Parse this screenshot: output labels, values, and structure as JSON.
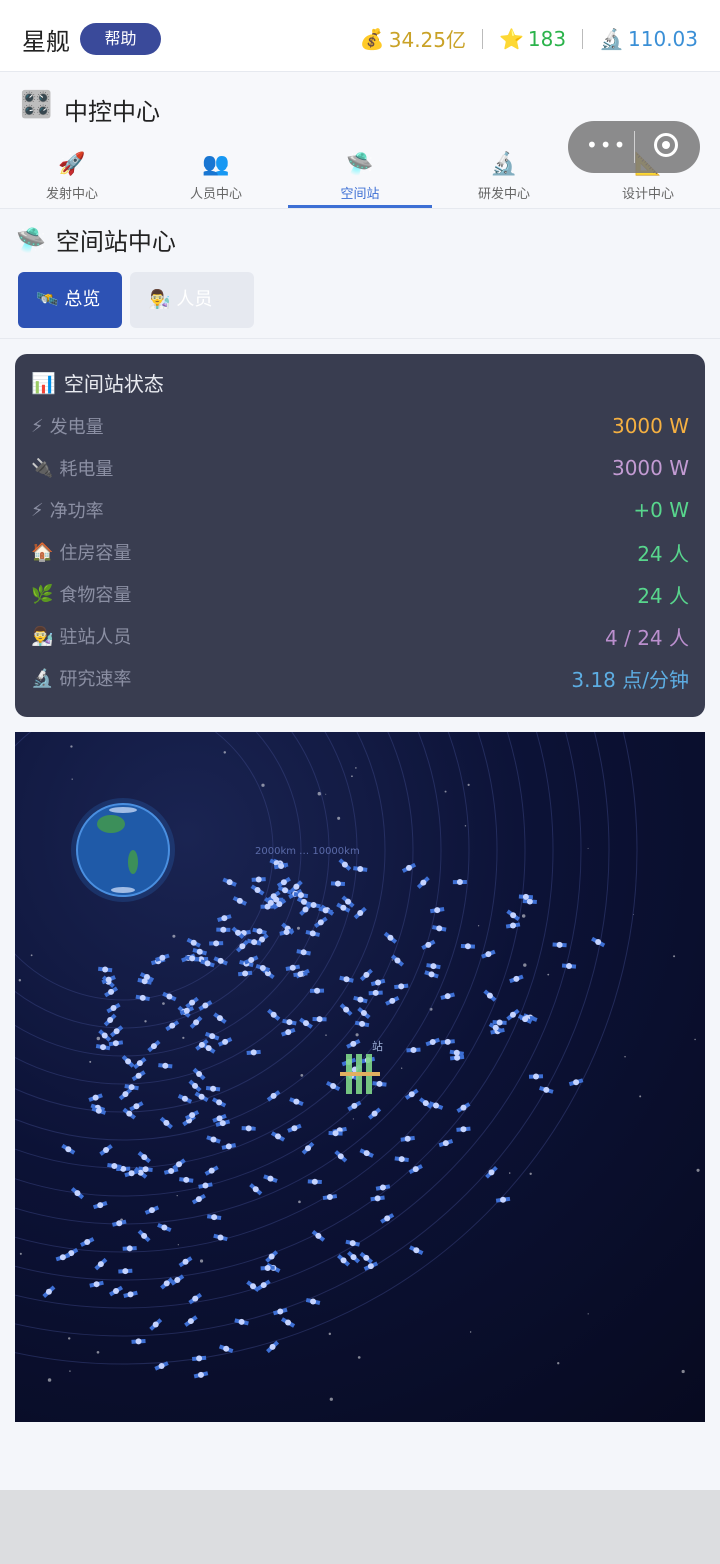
{
  "header": {
    "brand": "星舰",
    "help_label": "帮助",
    "money_icon": "💰",
    "money": "34.25亿",
    "star_icon": "⭐",
    "stars": "183",
    "research_icon": "🔬",
    "research": "110.03",
    "colors": {
      "money": "#c9a227",
      "stars": "#2bb34b",
      "research": "#3a8fd6"
    }
  },
  "control": {
    "icon": "🎛️",
    "title": "中控中心"
  },
  "capsule": {
    "more": "•••"
  },
  "tabs": [
    {
      "icon": "🚀",
      "label": "发射中心"
    },
    {
      "icon": "👥",
      "label": "人员中心"
    },
    {
      "icon": "🛸",
      "label": "空间站"
    },
    {
      "icon": "🔬",
      "label": "研发中心"
    },
    {
      "icon": "📐",
      "label": "设计中心"
    }
  ],
  "station": {
    "icon": "🛸",
    "title": "空间站中心",
    "subtab_overview_icon": "🛰️",
    "subtab_overview": "总览",
    "subtab_staff_icon": "👨‍🔬",
    "subtab_staff": "人员"
  },
  "status": {
    "icon": "📊",
    "title": "空间站状态",
    "rows": [
      {
        "icon": "⚡",
        "label": "发电量",
        "value": "3000 W",
        "color": "#f5b041"
      },
      {
        "icon": "🔌",
        "label": "耗电量",
        "value": "3000 W",
        "color": "#c39bd3"
      },
      {
        "icon": "⚡",
        "label": "净功率",
        "value": "+0 W",
        "color": "#58d68d"
      },
      {
        "icon": "🏠",
        "label": "住房容量",
        "value": "24 人",
        "color": "#58d68d"
      },
      {
        "icon": "🌿",
        "label": "食物容量",
        "value": "24 人",
        "color": "#58d68d"
      },
      {
        "icon": "👨‍🔬",
        "label": "驻站人员",
        "value": "4 / 24 人",
        "color": "#bb8fce"
      },
      {
        "icon": "🔬",
        "label": "研究速率",
        "value": "3.18 点/分钟",
        "color": "#5dade2"
      }
    ]
  },
  "map": {
    "orbit_labels": "2000km … 10000km",
    "station_label": "站"
  }
}
